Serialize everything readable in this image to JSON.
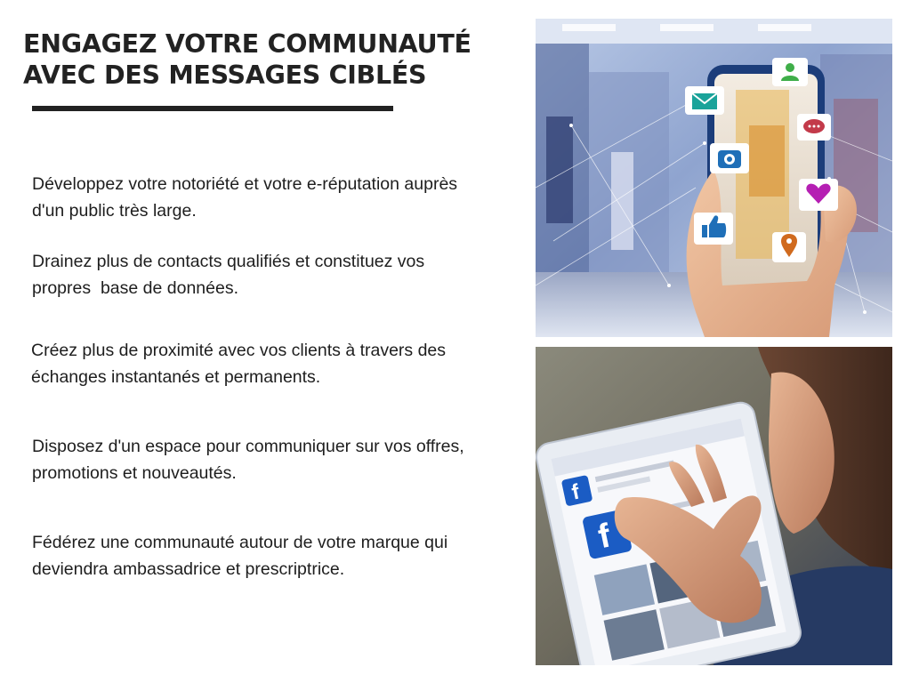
{
  "heading": {
    "line1": "ENGAGEZ VOTRE COMMUNAUTÉ",
    "line2": "AVEC DES MESSAGES CIBLÉS"
  },
  "paragraphs": [
    {
      "line1": "Développez votre notoriété et votre e-réputation auprès",
      "line2": "d'un public très large."
    },
    {
      "line1": "Drainez plus de contacts qualifiés et constituez vos",
      "line2": "propres  base de données."
    },
    {
      "line1": "Créez plus de proximité avec vos clients à travers des",
      "line2": "échanges instantanés et permanents."
    },
    {
      "line1": "Disposez d'un espace pour communiquer sur vos offres,",
      "line2": "promotions et nouveautés."
    },
    {
      "line1": "Fédérez une communauté autour de votre marque qui",
      "line2": "deviendra ambassadrice et prescriptrice."
    }
  ],
  "images": {
    "top": {
      "icons": [
        "user-icon",
        "mail-icon",
        "chat-icon",
        "camera-icon",
        "heart-icon",
        "thumbs-up-icon",
        "location-pin-icon"
      ]
    },
    "bottom": {
      "icons": [
        "facebook-logo-icon"
      ]
    }
  },
  "colors": {
    "text": "#1e1e1e",
    "heading": "#222222",
    "rule": "#222222",
    "background": "#ffffff",
    "icon_green": "#3fae49",
    "icon_teal": "#1aa39a",
    "icon_purple": "#b51fb3",
    "icon_blue": "#1f6fb8",
    "icon_orange": "#d06a1e",
    "icon_red": "#c33a4a",
    "facebook_blue": "#1b5cc4"
  }
}
